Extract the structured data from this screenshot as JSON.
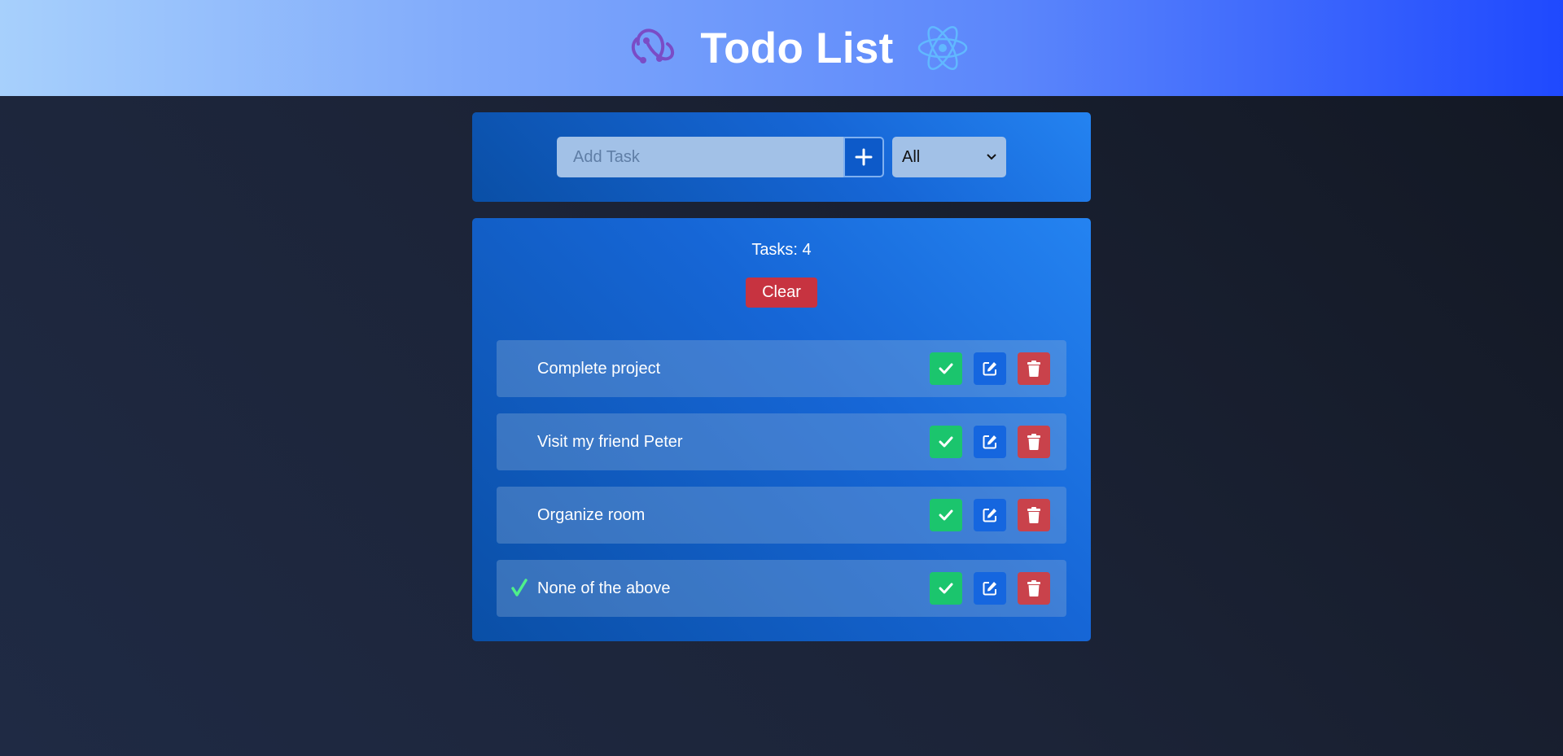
{
  "header": {
    "title": "Todo List",
    "left_logo": "redux-logo",
    "right_logo": "react-logo"
  },
  "add_task": {
    "placeholder": "Add Task",
    "value": "",
    "add_button_icon": "plus-icon",
    "filter_selected": "All"
  },
  "tasks_panel": {
    "count_text": "Tasks: 4",
    "clear_label": "Clear",
    "items": [
      {
        "text": "Complete project",
        "completed": false
      },
      {
        "text": "Visit my friend Peter",
        "completed": false
      },
      {
        "text": "Organize room",
        "completed": false
      },
      {
        "text": "None of the above",
        "completed": true
      }
    ]
  },
  "colors": {
    "accent_blue": "#1566df",
    "done_green": "#1bc56d",
    "delete_red": "#c9424b",
    "clear_red": "#c73340",
    "check_mark": "#4ff08a"
  }
}
